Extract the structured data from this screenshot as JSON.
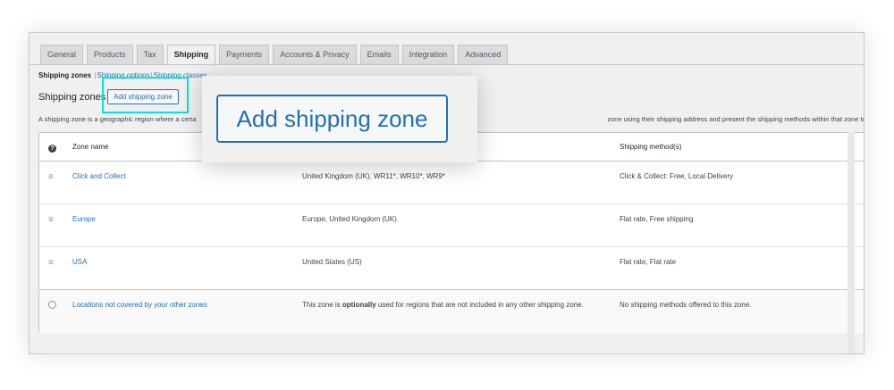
{
  "tabs": [
    {
      "label": "General",
      "active": false
    },
    {
      "label": "Products",
      "active": false
    },
    {
      "label": "Tax",
      "active": false
    },
    {
      "label": "Shipping",
      "active": true
    },
    {
      "label": "Payments",
      "active": false
    },
    {
      "label": "Accounts & Privacy",
      "active": false
    },
    {
      "label": "Emails",
      "active": false
    },
    {
      "label": "Integration",
      "active": false
    },
    {
      "label": "Advanced",
      "active": false
    }
  ],
  "subnav": {
    "current": "Shipping zones",
    "separator": "|",
    "options": "Shipping options",
    "classes": "Shipping classes"
  },
  "heading": "Shipping zones",
  "add_button": "Add shipping zone",
  "description_start": "A shipping zone is a geographic region where a certa",
  "description_end": "zone using their shipping address and present the shipping methods within that zone to them.",
  "table": {
    "headers": {
      "name": "Zone name",
      "methods": "Shipping method(s)"
    },
    "rows": [
      {
        "name": "Click and Collect",
        "region": "United Kingdom (UK), WR11*, WR10*, WR9*",
        "methods": "Click & Collect: Free, Local Delivery"
      },
      {
        "name": "Europe",
        "region": "Europe, United Kingdom (UK)",
        "methods": "Flat rate, Free shipping"
      },
      {
        "name": "USA",
        "region": "United States (US)",
        "methods": "Flat rate, Flat rate"
      }
    ],
    "fallback": {
      "name": "Locations not covered by your other zones",
      "region_pre": "This zone is ",
      "region_bold": "optionally",
      "region_post": " used for regions that are not included in any other shipping zone.",
      "methods": "No shipping methods offered to this zone."
    }
  },
  "icons": {
    "drag": "drag-handle-icon",
    "help": "help-icon",
    "globe": "globe-icon"
  },
  "colors": {
    "link": "#2271b1",
    "highlight": "#00e5d4",
    "background": "#f0f0f1"
  }
}
